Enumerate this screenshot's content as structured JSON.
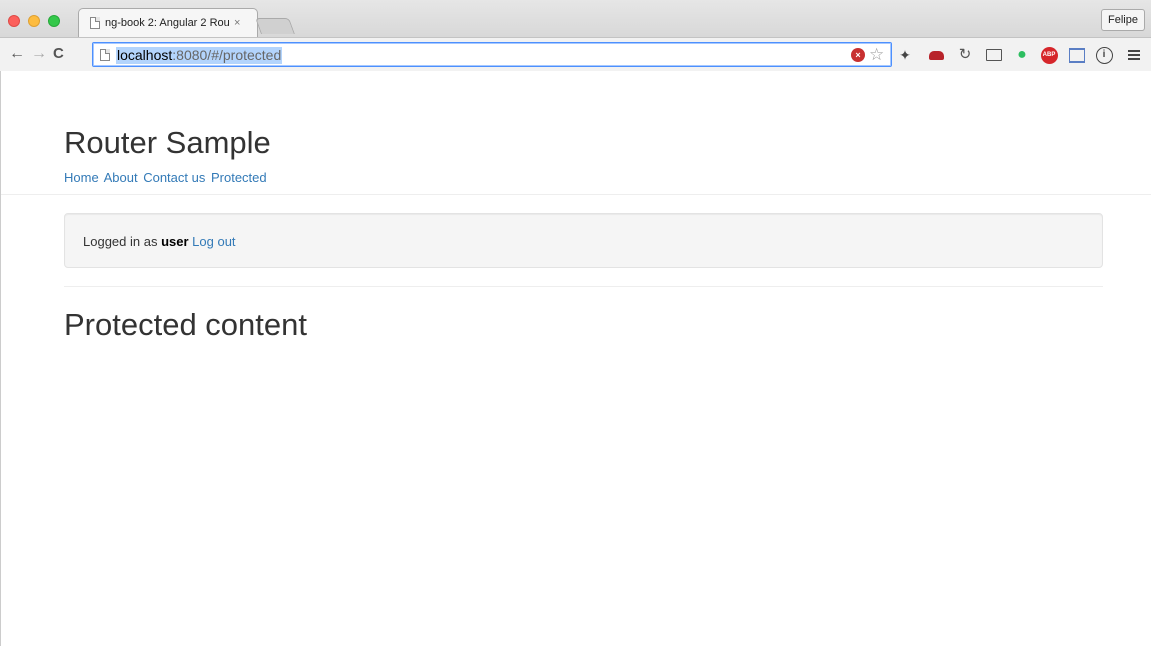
{
  "browser": {
    "tab_title": "ng-book 2: Angular 2 Router",
    "tab_close": "×",
    "profile_name": "Felipe",
    "url_host": "localhost",
    "url_rest": ":8080/#/protected",
    "icons": [
      "back-arrow-icon",
      "forward-arrow-icon",
      "reload-icon",
      "page-icon",
      "stop-icon",
      "bookmark-star-icon",
      "pin-extension-icon",
      "sofa-extension-icon",
      "sync-extension-icon",
      "cast-icon",
      "evernote-icon",
      "adblock-plus-icon",
      "frame-extension-icon",
      "info-extension-icon",
      "menu-icon"
    ]
  },
  "page": {
    "site_title": "Router Sample",
    "nav": {
      "home": "Home",
      "about": "About",
      "contact": "Contact us",
      "protected": "Protected"
    },
    "login": {
      "prefix": "Logged in as",
      "username": "user",
      "logout": "Log out"
    },
    "heading": "Protected content"
  },
  "colors": {
    "link": "#337ab7",
    "text": "#333333",
    "well_bg": "#f5f5f5",
    "url_selection": "#b3d4fc"
  }
}
